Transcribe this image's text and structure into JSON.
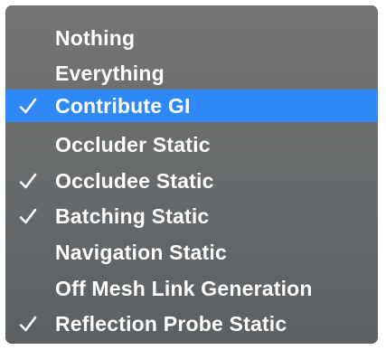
{
  "menu": {
    "items": [
      {
        "label": "Nothing",
        "checked": false,
        "highlighted": false
      },
      {
        "label": "Everything",
        "checked": false,
        "highlighted": false
      },
      {
        "label": "Contribute GI",
        "checked": true,
        "highlighted": true
      },
      {
        "label": "Occluder Static",
        "checked": false,
        "highlighted": false
      },
      {
        "label": "Occludee Static",
        "checked": true,
        "highlighted": false
      },
      {
        "label": "Batching Static",
        "checked": true,
        "highlighted": false
      },
      {
        "label": "Navigation Static",
        "checked": false,
        "highlighted": false
      },
      {
        "label": "Off Mesh Link Generation",
        "checked": false,
        "highlighted": false
      },
      {
        "label": "Reflection Probe Static",
        "checked": true,
        "highlighted": false
      }
    ]
  },
  "colors": {
    "highlight": "#2e88f5",
    "text": "#ffffff",
    "menu_background": "#6b6d6f"
  },
  "icons": {
    "check": "checkmark-icon"
  }
}
